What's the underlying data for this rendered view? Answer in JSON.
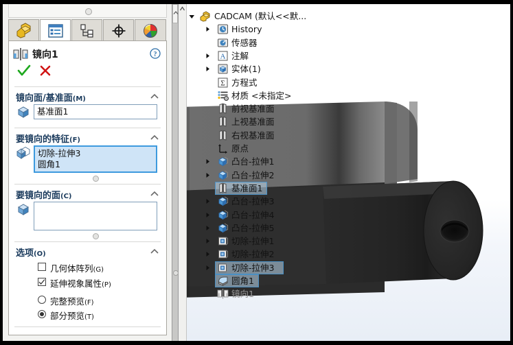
{
  "panel": {
    "tabs": [
      {
        "name": "feature-manager-tab",
        "icon": "yellow-part-icon",
        "selected": false
      },
      {
        "name": "property-manager-tab",
        "icon": "property-list-icon",
        "selected": true
      },
      {
        "name": "configuration-manager-tab",
        "icon": "configuration-icon",
        "selected": false
      },
      {
        "name": "dimxpert-manager-tab",
        "icon": "crosshair-icon",
        "selected": false
      },
      {
        "name": "display-manager-tab",
        "icon": "color-sphere-icon",
        "selected": false
      }
    ],
    "title": "镜向1",
    "title_icon": "mirror-icon",
    "help_icon": "help-question-icon",
    "accept_icon": "green-check-icon",
    "cancel_icon": "red-x-icon",
    "groups": {
      "mirror_face": {
        "label": "镜向面/基准面",
        "suffix": "(M)",
        "icon": "plane-cube-icon",
        "value": "基准面1"
      },
      "features_to_mirror": {
        "label": "要镜向的特征",
        "suffix": "(F)",
        "icon": "features-icon",
        "items": [
          "切除-拉伸3",
          "圆角1"
        ]
      },
      "faces_to_mirror": {
        "label": "要镜向的面",
        "suffix": "(C)",
        "icon": "face-cube-icon",
        "items": []
      },
      "options": {
        "label": "选项",
        "suffix": "(O)",
        "checkboxes": [
          {
            "label": "几何体阵列",
            "suffix": "(G)",
            "checked": false,
            "name": "geometry-pattern-checkbox"
          },
          {
            "label": "延伸视象属性",
            "suffix": "(P)",
            "checked": true,
            "name": "propagate-visual-properties-checkbox"
          }
        ],
        "radios": [
          {
            "label": "完整预览",
            "suffix": "(F)",
            "selected": false,
            "name": "full-preview-radio"
          },
          {
            "label": "部分预览",
            "suffix": "(T)",
            "selected": true,
            "name": "partial-preview-radio"
          }
        ]
      }
    }
  },
  "tree": {
    "root": {
      "label": "CADCAM  (默认<<默...",
      "icon": "part-icon",
      "expanded": true
    },
    "nodes": [
      {
        "label": "History",
        "icon": "history-icon",
        "indent": 1,
        "arrow": true,
        "selected": false,
        "dim": false
      },
      {
        "label": "传感器",
        "icon": "sensor-icon",
        "indent": 1,
        "arrow": false,
        "selected": false,
        "dim": false
      },
      {
        "label": "注解",
        "icon": "annotations-icon",
        "indent": 1,
        "arrow": true,
        "selected": false,
        "dim": false
      },
      {
        "label": "实体(1)",
        "icon": "solid-bodies-icon",
        "indent": 1,
        "arrow": true,
        "selected": false,
        "dim": false
      },
      {
        "label": "方程式",
        "icon": "equations-icon",
        "indent": 1,
        "arrow": false,
        "selected": false,
        "dim": false
      },
      {
        "label": "材质 <未指定>",
        "icon": "material-icon",
        "indent": 1,
        "arrow": false,
        "selected": false,
        "dim": false
      },
      {
        "label": "前视基准面",
        "icon": "plane-icon",
        "indent": 1,
        "arrow": false,
        "selected": false,
        "dim": false
      },
      {
        "label": "上视基准面",
        "icon": "plane-icon",
        "indent": 1,
        "arrow": false,
        "selected": false,
        "dim": false
      },
      {
        "label": "右视基准面",
        "icon": "plane-icon",
        "indent": 1,
        "arrow": false,
        "selected": false,
        "dim": false
      },
      {
        "label": "原点",
        "icon": "origin-icon",
        "indent": 1,
        "arrow": false,
        "selected": false,
        "dim": false
      },
      {
        "label": "凸台-拉伸1",
        "icon": "boss-extrude-icon",
        "indent": 1,
        "arrow": true,
        "selected": false,
        "dim": false
      },
      {
        "label": "凸台-拉伸2",
        "icon": "boss-extrude-icon",
        "indent": 1,
        "arrow": true,
        "selected": false,
        "dim": false
      },
      {
        "label": "基准面1",
        "icon": "plane-icon",
        "indent": 1,
        "arrow": false,
        "selected": true,
        "dim": false
      },
      {
        "label": "凸台-拉伸3",
        "icon": "boss-extrude-icon",
        "indent": 1,
        "arrow": true,
        "selected": false,
        "dim": false
      },
      {
        "label": "凸台-拉伸4",
        "icon": "boss-extrude-icon",
        "indent": 1,
        "arrow": true,
        "selected": false,
        "dim": false
      },
      {
        "label": "凸台-拉伸5",
        "icon": "boss-extrude-icon",
        "indent": 1,
        "arrow": true,
        "selected": false,
        "dim": false
      },
      {
        "label": "切除-拉伸1",
        "icon": "cut-extrude-icon",
        "indent": 1,
        "arrow": true,
        "selected": false,
        "dim": false
      },
      {
        "label": "切除-拉伸2",
        "icon": "cut-extrude-icon",
        "indent": 1,
        "arrow": true,
        "selected": false,
        "dim": false
      },
      {
        "label": "切除-拉伸3",
        "icon": "cut-extrude-icon",
        "indent": 1,
        "arrow": true,
        "selected": true,
        "dim": false
      },
      {
        "label": "圆角1",
        "icon": "fillet-icon",
        "indent": 1,
        "arrow": false,
        "selected": true,
        "dim": false
      },
      {
        "label": "镜向1",
        "icon": "mirror-icon",
        "indent": 1,
        "arrow": false,
        "selected": false,
        "dim": true
      }
    ]
  },
  "colors": {
    "preview_yellow": "#ffee00",
    "selection_blue": "#4a90c4",
    "selection_fill": "#cfe4f7",
    "group_header": "#1a3a5c",
    "model_top_face": "#6b6b6b",
    "model_dark_face": "#262626",
    "panel_bg": "#f2f2f0"
  }
}
